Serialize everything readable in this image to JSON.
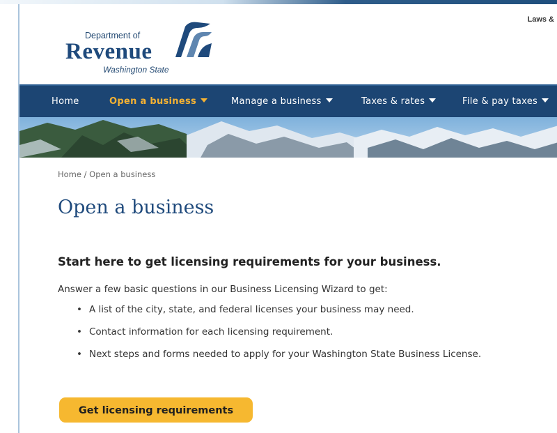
{
  "header": {
    "utility_link": "Laws &",
    "logo": {
      "dept": "Department of",
      "name": "Revenue",
      "state": "Washington State"
    }
  },
  "nav": {
    "items": [
      {
        "label": "Home",
        "dropdown": false,
        "active": false
      },
      {
        "label": "Open a business",
        "dropdown": true,
        "active": true
      },
      {
        "label": "Manage a business",
        "dropdown": true,
        "active": false
      },
      {
        "label": "Taxes & rates",
        "dropdown": true,
        "active": false
      },
      {
        "label": "File & pay taxes",
        "dropdown": true,
        "active": false
      }
    ]
  },
  "breadcrumb": {
    "home": "Home",
    "separator": " / ",
    "current": "Open a business"
  },
  "main": {
    "title": "Open a business",
    "subheading": "Start here to get licensing requirements for your business.",
    "intro": "Answer a few basic questions in our Business Licensing Wizard to get:",
    "bullets": [
      "A list of the city, state, and federal licenses your business may need.",
      "Contact information for each licensing requirement.",
      "Next steps and forms needed to apply for your Washington State Business License."
    ],
    "cta_label": "Get licensing requirements"
  },
  "colors": {
    "brand_navy": "#1c4573",
    "accent_gold": "#f5b233",
    "cta_yellow": "#f6b830",
    "title_blue": "#1f4a7c"
  }
}
